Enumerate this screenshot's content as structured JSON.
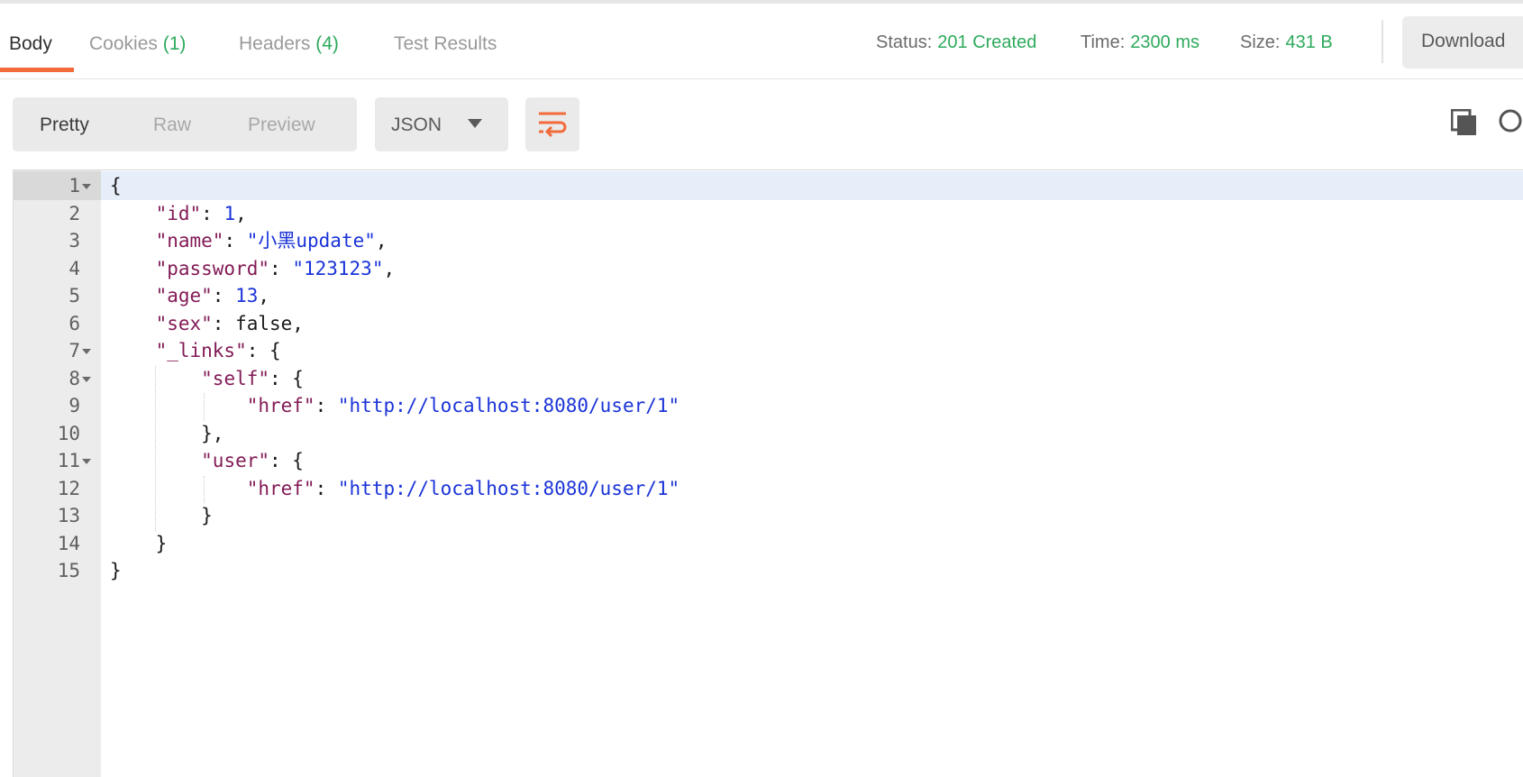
{
  "tabs": [
    {
      "label": "Body",
      "count": ""
    },
    {
      "label": "Cookies",
      "count": "(1)"
    },
    {
      "label": "Headers",
      "count": "(4)"
    },
    {
      "label": "Test Results",
      "count": ""
    }
  ],
  "status": {
    "status_label": "Status:",
    "status_value": "201 Created",
    "time_label": "Time:",
    "time_value": "2300 ms",
    "size_label": "Size:",
    "size_value": "431 B"
  },
  "download_label": "Download",
  "view_modes": [
    "Pretty",
    "Raw",
    "Preview"
  ],
  "active_view_mode": "Pretty",
  "format": "JSON",
  "colors": {
    "accent": "#f26b3a",
    "status_ok": "#2eaa5c",
    "json_key": "#831b56",
    "json_string": "#1a33d8"
  },
  "icons": [
    "chevron-down-icon",
    "wrap-lines-icon",
    "copy-icon",
    "search-icon",
    "fold-arrow-icon"
  ],
  "editor": {
    "line_numbers": [
      "1",
      "2",
      "3",
      "4",
      "5",
      "6",
      "7",
      "8",
      "9",
      "10",
      "11",
      "12",
      "13",
      "14",
      "15"
    ],
    "lines": [
      {
        "indent": "",
        "tokens": [
          {
            "t": "p",
            "v": "{"
          }
        ]
      },
      {
        "indent": "    ",
        "tokens": [
          {
            "t": "k",
            "v": "\"id\""
          },
          {
            "t": "p",
            "v": ": "
          },
          {
            "t": "n",
            "v": "1"
          },
          {
            "t": "p",
            "v": ","
          }
        ]
      },
      {
        "indent": "    ",
        "tokens": [
          {
            "t": "k",
            "v": "\"name\""
          },
          {
            "t": "p",
            "v": ": "
          },
          {
            "t": "s",
            "v": "\"小黑update\""
          },
          {
            "t": "p",
            "v": ","
          }
        ]
      },
      {
        "indent": "    ",
        "tokens": [
          {
            "t": "k",
            "v": "\"password\""
          },
          {
            "t": "p",
            "v": ": "
          },
          {
            "t": "s",
            "v": "\"123123\""
          },
          {
            "t": "p",
            "v": ","
          }
        ]
      },
      {
        "indent": "    ",
        "tokens": [
          {
            "t": "k",
            "v": "\"age\""
          },
          {
            "t": "p",
            "v": ": "
          },
          {
            "t": "n",
            "v": "13"
          },
          {
            "t": "p",
            "v": ","
          }
        ]
      },
      {
        "indent": "    ",
        "tokens": [
          {
            "t": "k",
            "v": "\"sex\""
          },
          {
            "t": "p",
            "v": ": false,"
          }
        ]
      },
      {
        "indent": "    ",
        "tokens": [
          {
            "t": "k",
            "v": "\"_links\""
          },
          {
            "t": "p",
            "v": ": {"
          }
        ]
      },
      {
        "indent": "        ",
        "tokens": [
          {
            "t": "k",
            "v": "\"self\""
          },
          {
            "t": "p",
            "v": ": {"
          }
        ]
      },
      {
        "indent": "            ",
        "tokens": [
          {
            "t": "k",
            "v": "\"href\""
          },
          {
            "t": "p",
            "v": ": "
          },
          {
            "t": "s",
            "v": "\"http://localhost:8080/user/1\""
          }
        ]
      },
      {
        "indent": "        ",
        "tokens": [
          {
            "t": "p",
            "v": "},"
          }
        ]
      },
      {
        "indent": "        ",
        "tokens": [
          {
            "t": "k",
            "v": "\"user\""
          },
          {
            "t": "p",
            "v": ": {"
          }
        ]
      },
      {
        "indent": "            ",
        "tokens": [
          {
            "t": "k",
            "v": "\"href\""
          },
          {
            "t": "p",
            "v": ": "
          },
          {
            "t": "s",
            "v": "\"http://localhost:8080/user/1\""
          }
        ]
      },
      {
        "indent": "        ",
        "tokens": [
          {
            "t": "p",
            "v": "}"
          }
        ]
      },
      {
        "indent": "    ",
        "tokens": [
          {
            "t": "p",
            "v": "}"
          }
        ]
      },
      {
        "indent": "",
        "tokens": [
          {
            "t": "p",
            "v": "}"
          }
        ]
      }
    ]
  }
}
